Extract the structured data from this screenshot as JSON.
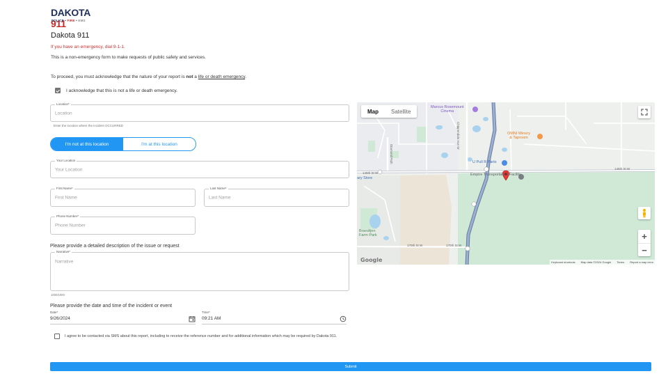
{
  "logo": {
    "main": "DAKOTA",
    "num": "911",
    "sub_police": "POLICE",
    "sub_fire": "FIRE",
    "sub_ems": "EMS",
    "sep": "•"
  },
  "page_title": "Dakota 911",
  "emergency_note": "If you have an emergency, dial 9-1-1.",
  "intro": "This is a non-emergency form to make requests of public safety and services.",
  "acknowledge": {
    "text_before": "To proceed, you must acknowledge that the nature of your report is ",
    "text_bold": "not",
    "text_between": " a ",
    "text_link": "life or death emergency",
    "text_after": ".",
    "checkbox_label": "I acknowledge that this is not a life or death emergency.",
    "checked": true
  },
  "location": {
    "label": "Location*",
    "placeholder": "Location",
    "helper": "Enter the location where the incident OCCURRED"
  },
  "toggle": {
    "not_at_location": "I'm not at this location",
    "at_location": "I'm at this location",
    "selected": "not_at_location"
  },
  "your_location": {
    "label": "Your Location",
    "placeholder": "Your Location"
  },
  "first_name": {
    "label": "First Name*",
    "placeholder": "First Name"
  },
  "last_name": {
    "label": "Last Name*",
    "placeholder": "Last Name"
  },
  "phone": {
    "label": "Phone Number*",
    "placeholder": "Phone Number"
  },
  "description": {
    "prompt": "Please provide a detailed description of the issue or request",
    "label": "Narrative*",
    "placeholder": "Narrative",
    "counter": "1000/1000"
  },
  "datetime": {
    "prompt": "Please provide the date and time of the incident or event",
    "date_label": "Date*",
    "date_value": "9/26/2024",
    "time_label": "Time*",
    "time_value": "09:21 AM"
  },
  "sms": {
    "label": "I agree to be contacted via SMS about this report, including to receive the reference number and for additional information which may be required by Dakota 911.",
    "checked": false
  },
  "submit_label": "Submit",
  "map": {
    "type_map": "Map",
    "type_satellite": "Satellite",
    "selected_type": "Map",
    "pois": {
      "marcus_line1": "Marcus Rosemount",
      "marcus_line2": "Cinema",
      "omni_line1": "OMNI Winery",
      "omni_line2": "& Taproom",
      "upull": "U Pull R Parts",
      "empire": "Empire Transportation Facility",
      "store": "ary Store",
      "brandtjen_line1": "Brandtjen",
      "brandtjen_line2": "Farm Park"
    },
    "roads": {
      "chippendale": "Chippendale Ave W",
      "diamond": "Diamond Path",
      "w145_east": "145th St W",
      "w145_west": "145th St W",
      "w170_a": "170th St W",
      "w170_b": "170th St W"
    },
    "google": "Google",
    "footer": [
      "Keyboard shortcuts",
      "Map data ©2024 Google",
      "Terms",
      "Report a map error"
    ]
  }
}
